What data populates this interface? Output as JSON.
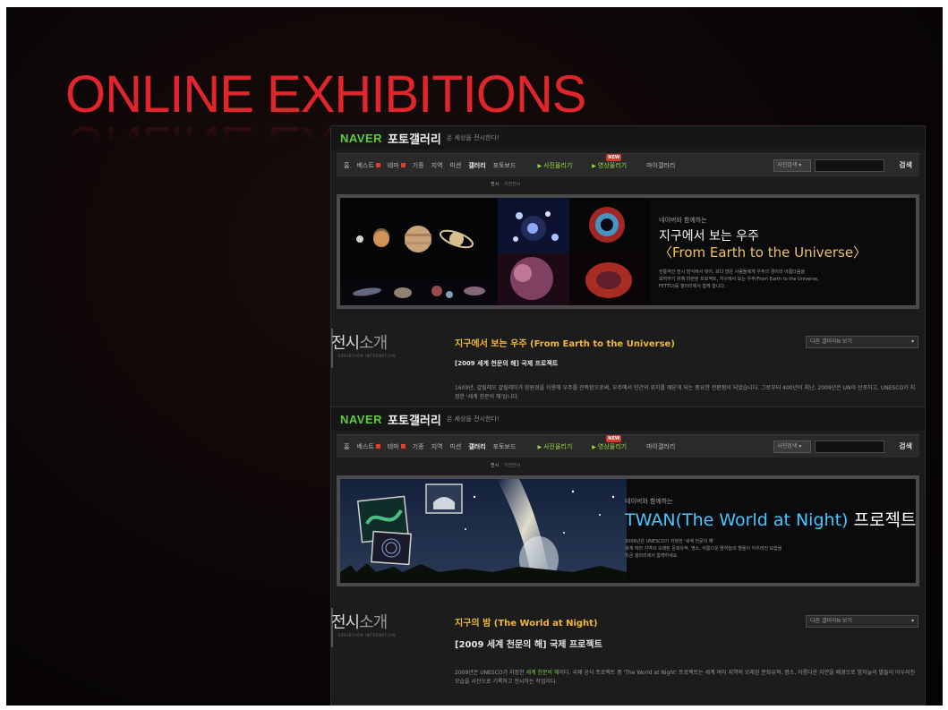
{
  "slide": {
    "title": "ONLINE EXHIBITIONS"
  },
  "screenshot_top": {
    "brand": "NAVER",
    "gallery_name": "포토갤러리",
    "slogan": "온 세상을 전시한다!",
    "nav_items": [
      "홈",
      "베스트",
      "테마",
      "기종",
      "지역",
      "미션",
      "갤러리",
      "포토보드"
    ],
    "nav_upload_photo": "사진올리기",
    "nav_upload_video": "영상올리기",
    "nav_my_gallery": "마이갤러리",
    "new_badge": "NEW",
    "search_select": "사진검색",
    "search_button": "검색",
    "subnav_active": "전시",
    "subnav_other": "이전전시",
    "banner": {
      "eyebrow": "네이버와 함께하는",
      "title_ko": "지구에서 보는 우주",
      "title_en": "〈From Earth to the Universe〉",
      "desc1": "전통적인 전시 방식에서 벗어, 보다 많은 사람들에게 우주의 경이와 아름다움을",
      "desc2": "보여주기 위해 마련된 프로젝트, 지구에서 보는 우주(From Earth to the Universe,",
      "desc3": "FETTU)를 갤러리에서 함께 합니다."
    },
    "intro": {
      "label_strong": "전시",
      "label_thin": "소개",
      "label_sub": "EXHIBITION INFORMATION",
      "title": "지구에서 보는 우주 (From Earth to the Universe)",
      "subtitle": "[2009 세계 천문의 해] 국제 프로젝트",
      "other_gallery": "다른 갤러리N 보기",
      "body": "1609년, 갈릴레오 갈릴레이가 망원경을 이용해 우주를 관측함으로써, 우주에서 인간의 위치를 깨닫게 되는 중요한 전환점이 되었습니다. 그로부터 400년이 지난, 2009년은 UN이 선포하고, UNESCO가 지정한 '세계 천문의 해'입니다."
    }
  },
  "screenshot_bottom": {
    "brand": "NAVER",
    "gallery_name": "포토갤러리",
    "slogan": "온 세상을 전시한다!",
    "nav_items": [
      "홈",
      "베스트",
      "테마",
      "기종",
      "지역",
      "미션",
      "갤러리",
      "포토보드"
    ],
    "nav_upload_photo": "사진올리기",
    "nav_upload_video": "영상올리기",
    "nav_my_gallery": "마이갤러리",
    "new_badge": "NEW",
    "search_select": "사진검색",
    "search_button": "검색",
    "subnav_active": "전시",
    "subnav_other": "이전전시",
    "banner": {
      "eyebrow": "네이버와 함께하는",
      "title_en": "TWAN(The World at Night)",
      "title_ko": "프로젝트",
      "desc1": "2009년은 UNESCO가 지정한 '세계 천문의 해'",
      "desc2": "세계 여러 지역의 오래된 문화유적, 명소, 아름다운 밤하늘의 별들이 어우러진 모습을",
      "desc3": "지금 갤러리에서 함께하세요."
    },
    "intro": {
      "label_strong": "전시",
      "label_thin": "소개",
      "label_sub": "EXHIBITION INFORMATION",
      "title": "지구의 밤 (The World at Night)",
      "subtitle": "[2009 세계 천문의 해] 국제 프로젝트",
      "other_gallery": "다른 갤러리N 보기",
      "body_pre": "2009년은 UNESCO가 지정한 ",
      "body_hl": "세계 천문의 해",
      "body_post": "이다. 국제 공식 프로젝트 중 'The World at Night' 프로젝트는 세계 여러 지역의 오래된 문화유적, 명소, 아름다운 자연을 배경으로 밤하늘의 별들이 어우러진 모습을 사진으로 기록하고 전시하는 작업이다."
    }
  },
  "colors": {
    "title_red": "#e0262b",
    "naver_green": "#5ecb3b",
    "accent_gold": "#f2c05a",
    "twan_blue": "#49c6ff"
  }
}
